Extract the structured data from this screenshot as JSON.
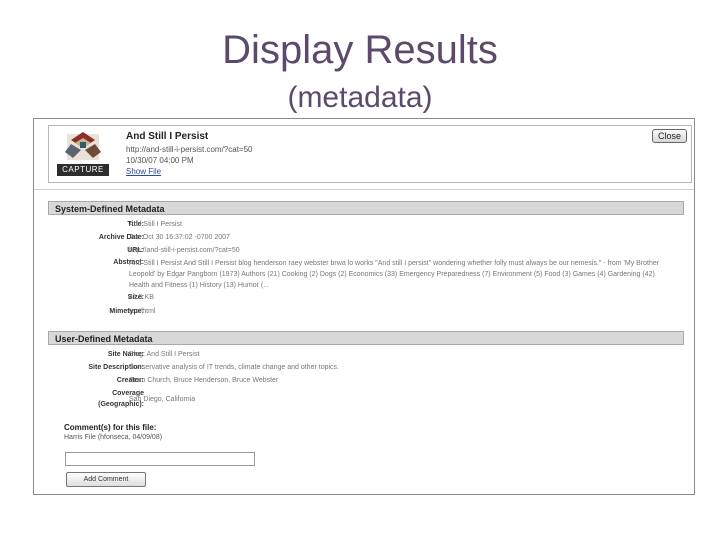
{
  "slide": {
    "title": "Display Results",
    "subtitle": "(metadata)"
  },
  "header": {
    "logo_text": "CAPTURE",
    "site_title": "And Still I Persist",
    "url": "http://and-still-i-persist.com/?cat=50",
    "capture_date": "10/30/07 04:00 PM",
    "show_file": "Show File",
    "close": "Close"
  },
  "system": {
    "heading": "System-Defined Metadata",
    "fields": [
      {
        "label": "Title:",
        "value": "And Still I Persist"
      },
      {
        "label": "Archive Date:",
        "value": "Tue Oct 30 16:37:02 -0700 2007"
      },
      {
        "label": "URL:",
        "value": "http://and-still-i-persist.com/?cat=50"
      },
      {
        "label": "Abstract:",
        "value": "And Still I Persist And Still I Persist blog henderson raey webster brwa lo works \"And still I persist\" wondering whether folly must always be our nemesis.\" - from 'My Brother Leopold' by Edgar Pangborn (1973) Authors (21) Cooking (2) Dogs (2) Economics (33) Emergency Preparedness (7) Environment (5) Food (3) Games (4) Gardening (42) Health and Fitness (1) History (13) Humor (..."
      },
      {
        "label": "Size:",
        "value": "41.5 KB"
      },
      {
        "label": "Mimetype:",
        "value": "text/html"
      }
    ]
  },
  "user": {
    "heading": "User-Defined Metadata",
    "fields": [
      {
        "label": "Site Name:",
        "value": "Blog: And Still I Persist"
      },
      {
        "label": "Site Description:",
        "value": "Conservative analysis of IT trends, climate change and other topics."
      },
      {
        "label": "Creator:",
        "value": "Sean Church, Bruce Henderson, Bruce Webster"
      },
      {
        "label": "Coverage",
        "value": "San Diego, California"
      },
      {
        "label": "(Geographic):",
        "value": ""
      }
    ],
    "comments_label": "Comment(s) for this file:",
    "comments_note": "Harris File (hfonseca, 04/09/08)",
    "comment_value": "",
    "add_comment": "Add Comment"
  }
}
